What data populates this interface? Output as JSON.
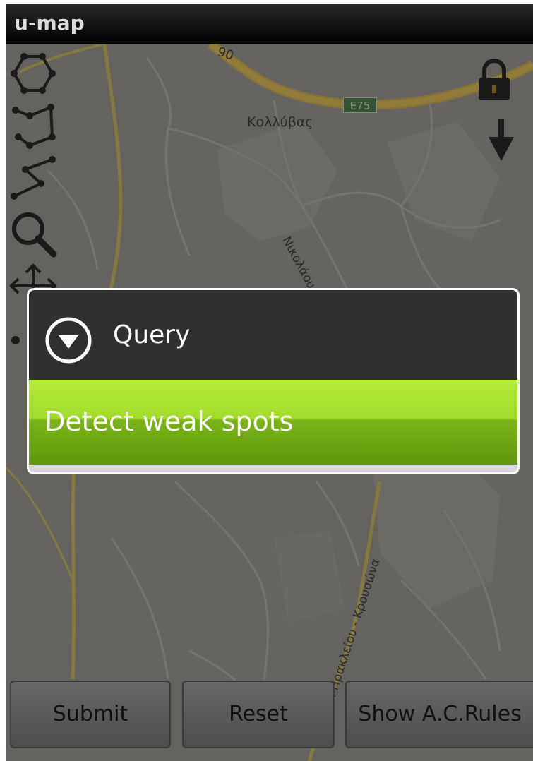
{
  "app": {
    "title": "u-map"
  },
  "map": {
    "place_label": "Κολλύβας",
    "road_label_1": "Νικολάου Πλασ",
    "road_label_2": "Ρ.Οδ. Ηρακλείου - Κρουσώνα",
    "road_number": "90",
    "road_shield": "E75"
  },
  "toolbar_left": [
    {
      "icon": "polygon-icon"
    },
    {
      "icon": "polyline-icon"
    },
    {
      "icon": "zigzag-line-icon"
    },
    {
      "icon": "magnifier-icon"
    },
    {
      "icon": "pan-move-icon"
    },
    {
      "icon": "point-icon"
    }
  ],
  "toolbar_right": [
    {
      "icon": "lock-icon"
    },
    {
      "icon": "arrow-down-icon"
    }
  ],
  "dialog": {
    "title": "Query",
    "icon": "expand-circle-icon",
    "items": [
      {
        "label": "Detect weak spots"
      }
    ]
  },
  "buttons": {
    "submit": "Submit",
    "reset": "Reset",
    "show_rules": "Show A.C.Rules"
  },
  "colors": {
    "menu_highlight": "#a2dc2a",
    "dialog_header": "#303030",
    "title_bar": "#000000"
  }
}
